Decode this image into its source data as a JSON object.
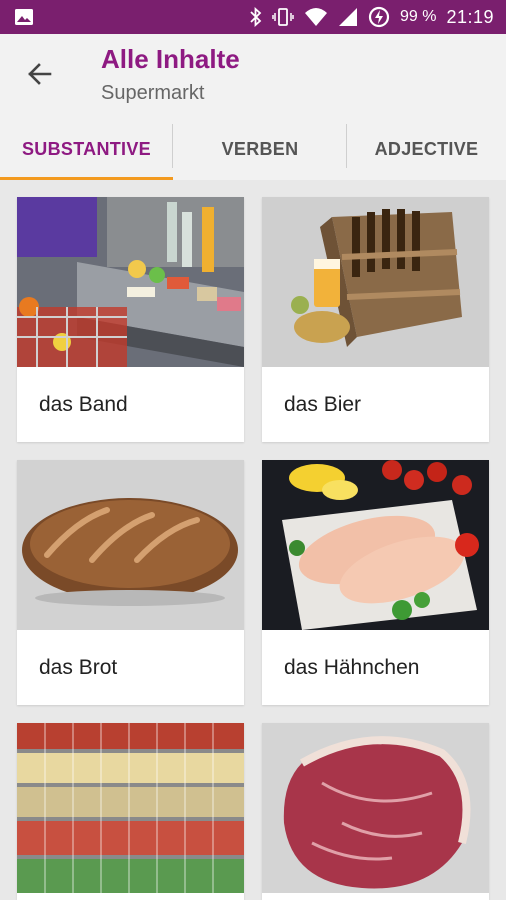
{
  "status_bar": {
    "battery": "99 %",
    "time": "21:19",
    "icons": [
      "image-icon",
      "bluetooth-icon",
      "vibrate-icon",
      "wifi-icon",
      "signal-icon",
      "battery-charging-icon"
    ]
  },
  "header": {
    "title": "Alle Inhalte",
    "subtitle": "Supermarkt",
    "accent_color": "#8e1a82"
  },
  "tabs": [
    {
      "label": "SUBSTANTIVE",
      "active": true
    },
    {
      "label": "VERBEN",
      "active": false
    },
    {
      "label": "ADJECTIVE",
      "active": false
    }
  ],
  "cards": [
    {
      "label": "das Band",
      "image": "checkout-belt-photo"
    },
    {
      "label": "das Bier",
      "image": "beer-crate-photo"
    },
    {
      "label": "das Brot",
      "image": "bread-loaf-photo"
    },
    {
      "label": "das Hähnchen",
      "image": "chicken-breast-photo"
    },
    {
      "label": "",
      "image": "supermarket-shelves-photo"
    },
    {
      "label": "",
      "image": "raw-steak-photo"
    }
  ]
}
